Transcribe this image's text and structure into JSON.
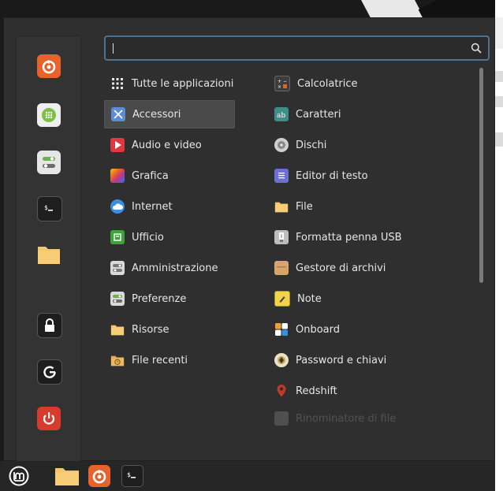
{
  "search": {
    "value": "",
    "placeholder": ""
  },
  "sidebar": {
    "favorites": [
      {
        "name": "firefox",
        "icon": "firefox-icon"
      },
      {
        "name": "software-manager",
        "icon": "software-manager-icon"
      },
      {
        "name": "system-settings",
        "icon": "settings-icon"
      },
      {
        "name": "terminal",
        "icon": "terminal-icon"
      },
      {
        "name": "files",
        "icon": "folder-icon"
      }
    ],
    "session": [
      {
        "name": "lock-screen",
        "icon": "lock-icon"
      },
      {
        "name": "logout",
        "icon": "logout-icon"
      },
      {
        "name": "shutdown",
        "icon": "power-icon"
      }
    ]
  },
  "categories": [
    {
      "label": "Tutte le applicazioni",
      "icon": "all-apps-grid-icon"
    },
    {
      "label": "Accessori",
      "icon": "accessories-icon",
      "selected": true
    },
    {
      "label": "Audio e video",
      "icon": "multimedia-icon"
    },
    {
      "label": "Grafica",
      "icon": "graphics-icon"
    },
    {
      "label": "Internet",
      "icon": "internet-cloud-icon"
    },
    {
      "label": "Ufficio",
      "icon": "office-icon"
    },
    {
      "label": "Amministrazione",
      "icon": "administration-icon"
    },
    {
      "label": "Preferenze",
      "icon": "preferences-icon"
    },
    {
      "label": "Risorse",
      "icon": "places-folder-icon"
    },
    {
      "label": "File recenti",
      "icon": "recent-files-icon"
    }
  ],
  "apps": [
    {
      "label": "Calcolatrice",
      "icon": "calculator-icon"
    },
    {
      "label": "Caratteri",
      "icon": "fonts-icon"
    },
    {
      "label": "Dischi",
      "icon": "disks-icon"
    },
    {
      "label": "Editor di testo",
      "icon": "text-editor-icon"
    },
    {
      "label": "File",
      "icon": "folder-icon"
    },
    {
      "label": "Formatta penna USB",
      "icon": "usb-icon"
    },
    {
      "label": "Gestore di archivi",
      "icon": "archive-icon"
    },
    {
      "label": "Note",
      "icon": "notes-icon"
    },
    {
      "label": "Onboard",
      "icon": "onboard-keyboard-icon"
    },
    {
      "label": "Password e chiavi",
      "icon": "passwords-keys-icon"
    },
    {
      "label": "Redshift",
      "icon": "redshift-icon"
    },
    {
      "label": "Rinominatore di file",
      "icon": "bulk-rename-icon",
      "faded": true
    }
  ],
  "taskbar": {
    "items": [
      "menu-button",
      "files-launcher",
      "firefox-launcher",
      "terminal-launcher"
    ]
  },
  "colors": {
    "menu_bg": "#2f2f2f",
    "selection_bg": "#4a4a4a",
    "search_border": "#4e7390",
    "firefox_orange": "#e8632b",
    "power_red": "#d83a2e",
    "folder_yellow": "#f4c56b"
  }
}
